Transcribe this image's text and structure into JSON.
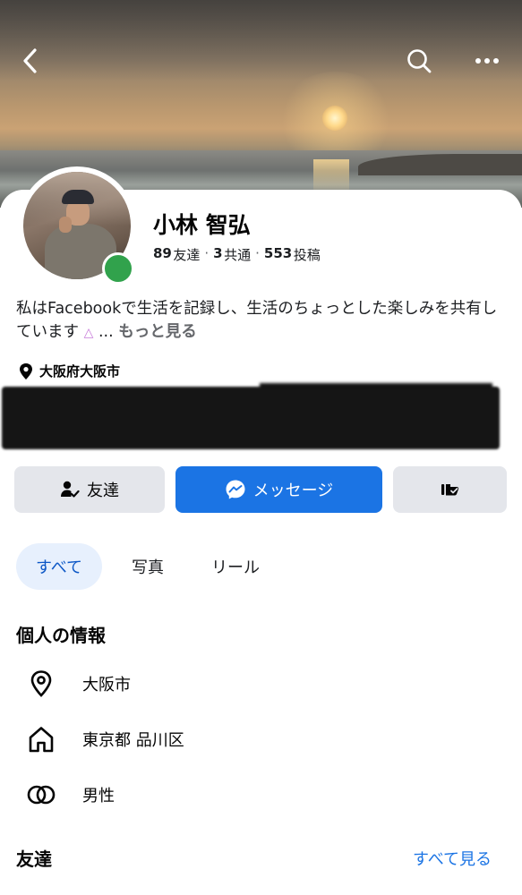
{
  "header": {
    "back_icon": "chevron-left-icon",
    "search_icon": "search-icon",
    "more_icon": "more-horizontal-icon"
  },
  "profile": {
    "name": "小林 智弘",
    "stats": {
      "friends_count": "89",
      "friends_label": "友達",
      "mutual_count": "3",
      "mutual_label": "共通",
      "posts_count": "553",
      "posts_label": "投稿",
      "separator": "·"
    },
    "online_status_color": "#31a24c",
    "bio": {
      "text": "私はFacebookで生活を記録し、生活のちょっとした楽しみを共有しています",
      "ellipsis": "...",
      "more_label": "もっと見る"
    },
    "location": "大阪府大阪市"
  },
  "actions": {
    "friends_label": "友達",
    "message_label": "メッセージ",
    "message_color": "#1b74e4"
  },
  "tabs": [
    {
      "label": "すべて",
      "selected": true
    },
    {
      "label": "写真",
      "selected": false
    },
    {
      "label": "リール",
      "selected": false
    }
  ],
  "personal_info": {
    "title": "個人の情報",
    "items": [
      {
        "icon": "map-pin-icon",
        "text": "大阪市"
      },
      {
        "icon": "home-icon",
        "text": "東京都 品川区"
      },
      {
        "icon": "gender-icon",
        "text": "男性"
      }
    ]
  },
  "friends_section": {
    "title": "友達",
    "see_all_label": "すべて見る"
  }
}
